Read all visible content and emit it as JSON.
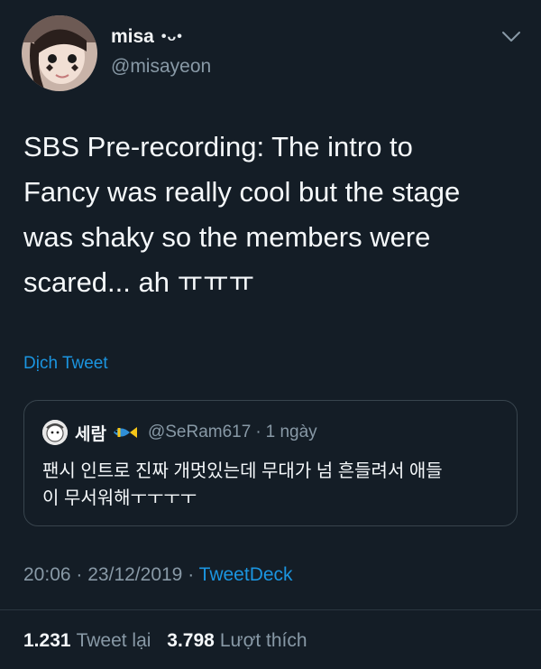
{
  "author": {
    "display_name": "misa",
    "name_emoji": "•ᴗ•",
    "handle": "@misayeon",
    "avatar_icon": "user-avatar-photo"
  },
  "tweet": {
    "text_lines": [
      "SBS Pre-recording: The intro to",
      "Fancy was really cool but the stage",
      "was shaky so the members were",
      "scared... ah ㅠㅠㅠ"
    ],
    "translate_label": "Dịch Tweet"
  },
  "quoted": {
    "display_name": "세람",
    "name_emoji_icon": "tropical-fish-icon",
    "handle": "@SeRam617",
    "separator": "·",
    "time": "1 ngày",
    "text_lines": [
      "팬시 인트로 진짜 개멋있는데 무대가 넘 흔들려서 애들",
      "이 무서워해ㅜㅜㅜㅜ"
    ]
  },
  "meta": {
    "time": "20:06",
    "sep1": "·",
    "date": "23/12/2019",
    "sep2": "·",
    "source": "TweetDeck"
  },
  "stats": {
    "retweets_count": "1.231",
    "retweets_label": "Tweet lại",
    "likes_count": "3.798",
    "likes_label": "Lượt thích"
  },
  "colors": {
    "background": "#141d26",
    "link": "#1b95e0",
    "muted": "#8899a6",
    "border": "#38444d"
  }
}
